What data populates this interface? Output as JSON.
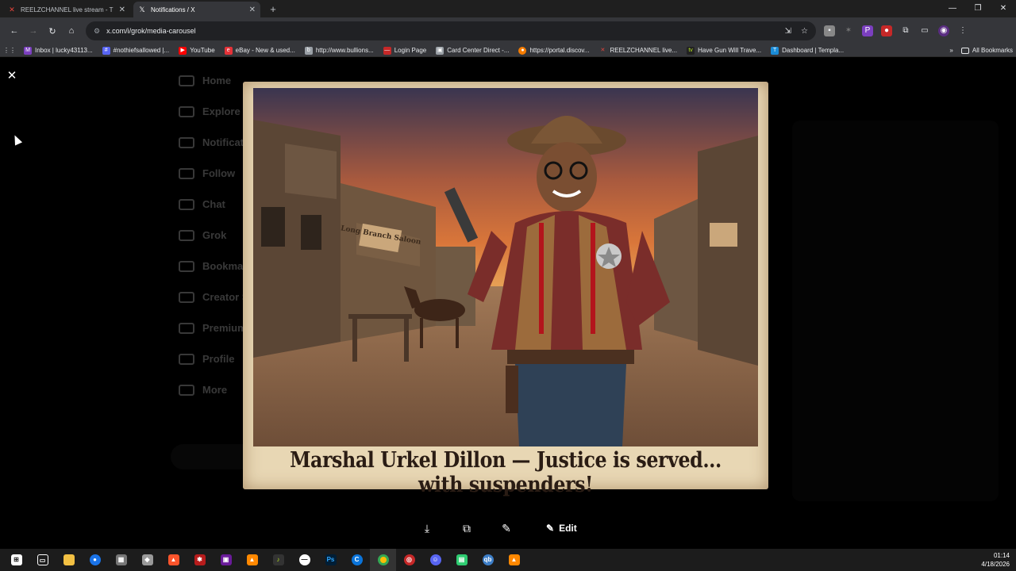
{
  "tabs": [
    {
      "title": "REELZCHANNEL live stream - T",
      "icon": "reelz-icon",
      "color": "#e8453c"
    },
    {
      "title": "Notifications / X",
      "icon": "x-logo-icon",
      "color": "#ffffff"
    }
  ],
  "address": "x.com/i/grok/media-carousel",
  "bookmarks": [
    {
      "label": "Inbox | lucky43113...",
      "color": "#7b3fbf",
      "glyph": "M"
    },
    {
      "label": "#nothiefsallowed |...",
      "color": "#5865f2",
      "glyph": "#"
    },
    {
      "label": "YouTube",
      "color": "#ff0000",
      "glyph": "▶"
    },
    {
      "label": "eBay - New & used...",
      "color": "#e53238",
      "glyph": "e"
    },
    {
      "label": "http://www.bullions...",
      "color": "#9aa0a6",
      "glyph": "b"
    },
    {
      "label": "Login Page",
      "color": "#c62828",
      "glyph": "—"
    },
    {
      "label": "Card Center Direct -...",
      "color": "#9aa0a6",
      "glyph": "▣"
    },
    {
      "label": "https://portal.discov...",
      "color": "#f57c00",
      "glyph": "●"
    },
    {
      "label": "REELZCHANNEL live...",
      "color": "#e8453c",
      "glyph": "✕"
    },
    {
      "label": "Have Gun Will Trave...",
      "color": "#222",
      "glyph": "tv"
    },
    {
      "label": "Dashboard | Templa...",
      "color": "#1a8cd8",
      "glyph": "T"
    }
  ],
  "all_bookmarks_label": "All Bookmarks",
  "background_nav": [
    "Home",
    "Explore",
    "Notifications",
    "Follow",
    "Chat",
    "Grok",
    "Bookmarks",
    "Creator Studio",
    "Premium",
    "Profile",
    "More"
  ],
  "media": {
    "caption": "Marshal Urkel Dillon — Justice is served... with suspenders!",
    "saloon_sign": "Long Branch Saloon",
    "edit_label": "Edit"
  },
  "clock": {
    "time": "01:14",
    "date": "4/18/2026"
  },
  "colors": {
    "frame": "#e8d7b4",
    "caption_ink": "#2a1c14",
    "sky_top": "#3a3550",
    "sky_mid": "#d9763a",
    "ground": "#8a6448"
  }
}
